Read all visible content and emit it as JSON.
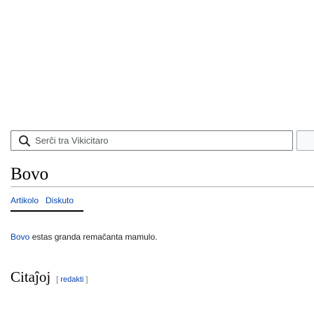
{
  "search": {
    "placeholder": "Serĉi tra Vikicitaro",
    "icon": "search-icon"
  },
  "page": {
    "title": "Bovo"
  },
  "tabs": [
    {
      "label": "Artikolo",
      "active": true
    },
    {
      "label": "Diskuto",
      "active": false
    }
  ],
  "content": {
    "subject": "Bovo",
    "rest": " estas granda remaĉanta mamulo."
  },
  "section": {
    "title": "Citaĵoj",
    "edit_open": "[ ",
    "edit_label": "redakti",
    "edit_close": " ]"
  },
  "colors": {
    "link": "#0645ad",
    "text": "#202122",
    "border": "#a2a9b1"
  }
}
